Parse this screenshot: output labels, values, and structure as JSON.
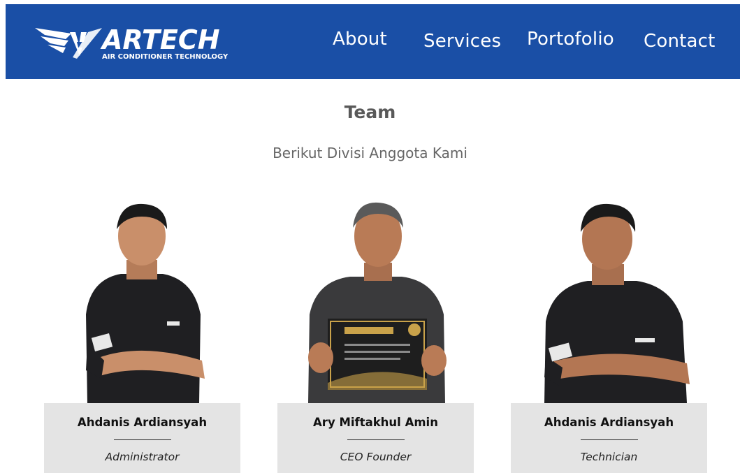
{
  "header": {
    "logo": {
      "wordmark": "ARTECH",
      "tagline": "AIR CONDITIONER TECHNOLOGY"
    },
    "nav": [
      {
        "label": "About"
      },
      {
        "label": "Services"
      },
      {
        "label": "Portofolio"
      },
      {
        "label": "Contact"
      }
    ]
  },
  "team": {
    "title": "Team",
    "subtitle": "Berikut Divisi Anggota Kami",
    "members": [
      {
        "name": "Ahdanis Ardiansyah",
        "role": "Administrator",
        "photo": "person-arms-crossed-photo"
      },
      {
        "name": "Ary Miftakhul Amin",
        "role": "CEO Founder",
        "photo": "person-holding-certificate-photo"
      },
      {
        "name": "Ahdanis Ardiansyah",
        "role": "Technician",
        "photo": "person-arms-crossed-photo"
      }
    ]
  },
  "colors": {
    "navbar": "#1a4fa6",
    "card": "#e4e4e4",
    "shirt": "#1f1f22",
    "skin": "#c98f6a"
  }
}
